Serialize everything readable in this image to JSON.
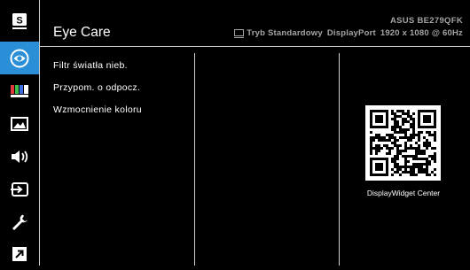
{
  "sidebar": {
    "items": [
      {
        "name": "splendid-icon",
        "active": false
      },
      {
        "name": "eye-care-icon",
        "active": true
      },
      {
        "name": "color-icon",
        "active": false
      },
      {
        "name": "image-icon",
        "active": false
      },
      {
        "name": "sound-icon",
        "active": false
      },
      {
        "name": "input-select-icon",
        "active": false
      },
      {
        "name": "system-setup-icon",
        "active": false
      },
      {
        "name": "shortcut-icon",
        "active": false
      }
    ]
  },
  "header": {
    "title": "Eye Care",
    "model": "ASUS BE279QFK",
    "mode": "Tryb Standardowy",
    "input": "DisplayPort",
    "resolution": "1920 x 1080 @ 60Hz"
  },
  "menu": {
    "items": [
      {
        "label": "Filtr światła nieb."
      },
      {
        "label": "Przypom. o odpocz."
      },
      {
        "label": "Wzmocnienie koloru"
      }
    ]
  },
  "qr": {
    "caption": "DisplayWidget Center"
  },
  "colors": {
    "active_accent": "#2a8fd7",
    "background": "#000000",
    "divider": "#cfcfcf",
    "header_text": "#a4a4a4"
  }
}
